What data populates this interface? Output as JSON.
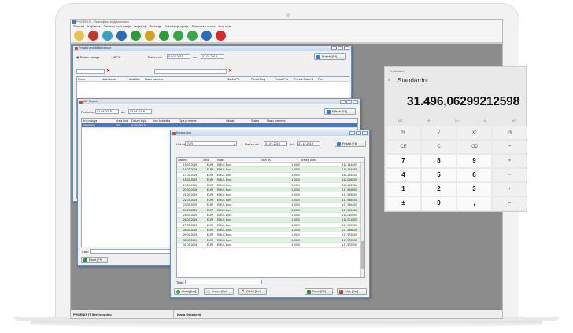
{
  "app": {
    "title": "PHOENIX - Financijsko knjigovodstvo",
    "menu": [
      "Šifarnici",
      "Knjiženja",
      "Devizno poslovanje",
      "Izvještaji",
      "Plaćanje",
      "Pokretanje opcije",
      "Sistemske opcije",
      "Kraj rada"
    ],
    "status_company": "PHOENIX IT Services doo",
    "status_user": "Ivana Obradović"
  },
  "icons": [
    "notepad-icon",
    "dice-icon",
    "chart-icon",
    "chair-icon",
    "arrow-up-icon",
    "bar-chart-icon",
    "recycle-icon",
    "at-icon",
    "clock-icon",
    "info-icon",
    "power-icon"
  ],
  "win1": {
    "title": "Pregled analitičkih računa",
    "radio_datum": "Datum naloga",
    "radio_dpo": "DPO",
    "datum_od_label": "Datum od:",
    "date_from": "01.01.2019",
    "do_label": "do:",
    "date_to": "03.04.2019",
    "show_button": "Prikaži [F8]",
    "columns": [
      "Konto",
      "Naziv konta",
      "Analitika",
      "Naziv partnera",
      "Saldo PS",
      "Period Dug",
      "Period Pot",
      "Period Saldo D",
      "Peri"
    ]
  },
  "win2": {
    "title": "KIF Reports",
    "period_label": "Period od:",
    "date_from": "01.04.2019",
    "do_label": "do:",
    "date_to": "03.04.2019",
    "show_button": "Prikaži [F8]",
    "columns": [
      "Broj naloga",
      "Vrsta Dok",
      "Datum knjiž.",
      "Ime korisnika",
      "Opis promene",
      "Oblast",
      "Status",
      "Naziv partnera"
    ],
    "rows": [
      [
        "KR-00006",
        "KR",
        "01.04.2019"
      ]
    ],
    "search_label": "Traži:",
    "excel_button": "Excel [F9]"
  },
  "win3": {
    "title": "Kursna lista",
    "valuta_label": "Valuta:",
    "valuta_value": "EUR",
    "datum_od_label": "Datum od:",
    "date_from": "01.01.2019",
    "do_label": "do:",
    "date_to": "31.12.2019",
    "show_button": "Prikaži [F8]",
    "columns": [
      "Datum",
      "Šifra",
      "Naziv",
      "Važi za",
      "Srednji kurs"
    ],
    "rows": [
      [
        "15.03.2019",
        "EUR",
        "EMU - Euro",
        "1,0000",
        "118,154400"
      ],
      [
        "16.03.2019",
        "EUR",
        "EMU - Euro",
        "1,0000",
        "118,154400"
      ],
      [
        "17.03.2019",
        "EUR",
        "EMU - Euro",
        "1,0000",
        "118,154400"
      ],
      [
        "18.03.2019",
        "EUR",
        "EMU - Euro",
        "1,0000",
        "118,066000"
      ],
      [
        "19.03.2019",
        "EUR",
        "EMU - Euro",
        "1,0000",
        "118,063900"
      ],
      [
        "20.03.2019",
        "EUR",
        "EMU - Euro",
        "1,0000",
        "117,944600"
      ],
      [
        "21.03.2019",
        "EUR",
        "EMU - Euro",
        "1,0000",
        "117,925000"
      ],
      [
        "22.03.2019",
        "EUR",
        "EMU - Euro",
        "1,0000",
        "117,946400"
      ],
      [
        "23.03.2019",
        "EUR",
        "EMU - Euro",
        "1,0000",
        "117,946400"
      ],
      [
        "24.03.2019",
        "EUR",
        "EMU - Euro",
        "1,0000",
        "117,946400"
      ],
      [
        "25.03.2019",
        "EUR",
        "EMU - Euro",
        "1,0000",
        "118,030000"
      ],
      [
        "26.03.2019",
        "EUR",
        "EMU - Euro",
        "1,0000",
        "118,001500"
      ],
      [
        "27.03.2019",
        "EUR",
        "EMU - Euro",
        "1,0000",
        "117,995700"
      ],
      [
        "28.03.2019",
        "EUR",
        "EMU - Euro",
        "1,0000",
        "117,986800"
      ],
      [
        "29.03.2019",
        "EUR",
        "EMU - Euro",
        "1,0000",
        "117,972000"
      ],
      [
        "30.03.2019",
        "EUR",
        "EMU - Euro",
        "1,0000",
        "117,972000"
      ],
      [
        "31.03.2019",
        "EUR",
        "EMU - Euro",
        "1,0000",
        "117,972000"
      ]
    ],
    "search_label": "Traži:",
    "add_button": "Dodaj [Ins]",
    "edit_button": "Izmeni [Ent]",
    "delete_button": "Obriši [Del]",
    "excel_button": "Excel [F9]",
    "exit_button": "Izlaz [Esc]"
  },
  "calculator": {
    "title": "Kalkulator",
    "mode": "Standardni",
    "display": "31.496,06299212598",
    "memory": [
      "MC",
      "MR",
      "M+",
      "M-",
      "MS"
    ],
    "keys": [
      [
        "%",
        "√",
        "x²",
        "¹⁄x"
      ],
      [
        "CE",
        "C",
        "⌫",
        "÷"
      ],
      [
        "7",
        "8",
        "9",
        "×"
      ],
      [
        "4",
        "5",
        "6",
        "−"
      ],
      [
        "1",
        "2",
        "3",
        "+"
      ],
      [
        "±",
        "0",
        ",",
        "="
      ]
    ]
  },
  "colors": {
    "accent": "#3d7ad6",
    "grid_alt": "#dff2df",
    "desktop": "#8c8c8c",
    "title_gradient": "#c7d8ee"
  }
}
